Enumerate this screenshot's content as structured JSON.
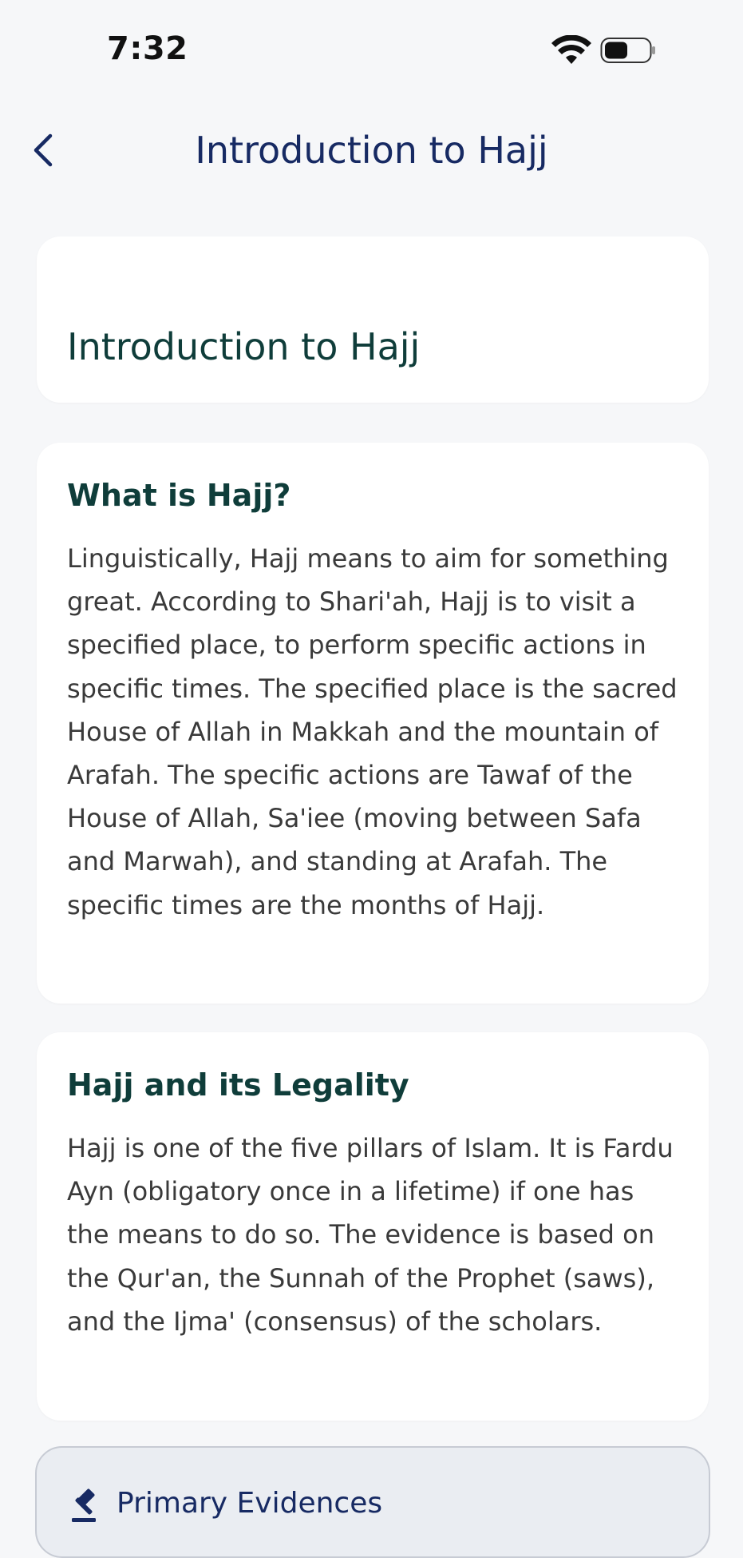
{
  "status_bar": {
    "time": "7:32",
    "icons": [
      "wifi-icon",
      "battery-icon"
    ]
  },
  "header": {
    "back_icon": "chevron-left-icon",
    "title": "Introduction to Hajj"
  },
  "title_card": {
    "title": "Introduction to Hajj"
  },
  "sections": [
    {
      "heading": "What is Hajj?",
      "body": "Linguistically, Hajj means to aim for something great. According to Shari'ah, Hajj is to visit a specified place, to perform specific actions in specific times. The specified place is the sacred House of Allah in Makkah and the mountain of Arafah. The specific actions are Tawaf of the House of Allah, Sa'iee (moving between Safa and Marwah), and standing at Arafah. The specific times are the months of Hajj."
    },
    {
      "heading": "Hajj and its Legality",
      "body": "Hajj is one of the five pillars of Islam. It is Fardu Ayn (obligatory once in a lifetime) if one has the means to do so. The evidence is based on the Qur'an, the Sunnah of the Prophet (saws), and the Ijma' (consensus) of the scholars."
    }
  ],
  "evidence": {
    "icon": "gavel-icon",
    "label": "Primary Evidences"
  },
  "colors": {
    "background": "#f6f7f9",
    "navy": "#172a63",
    "teal_heading": "#0f3d3a",
    "card": "#ffffff",
    "evidence_bg": "#eaedf2"
  }
}
